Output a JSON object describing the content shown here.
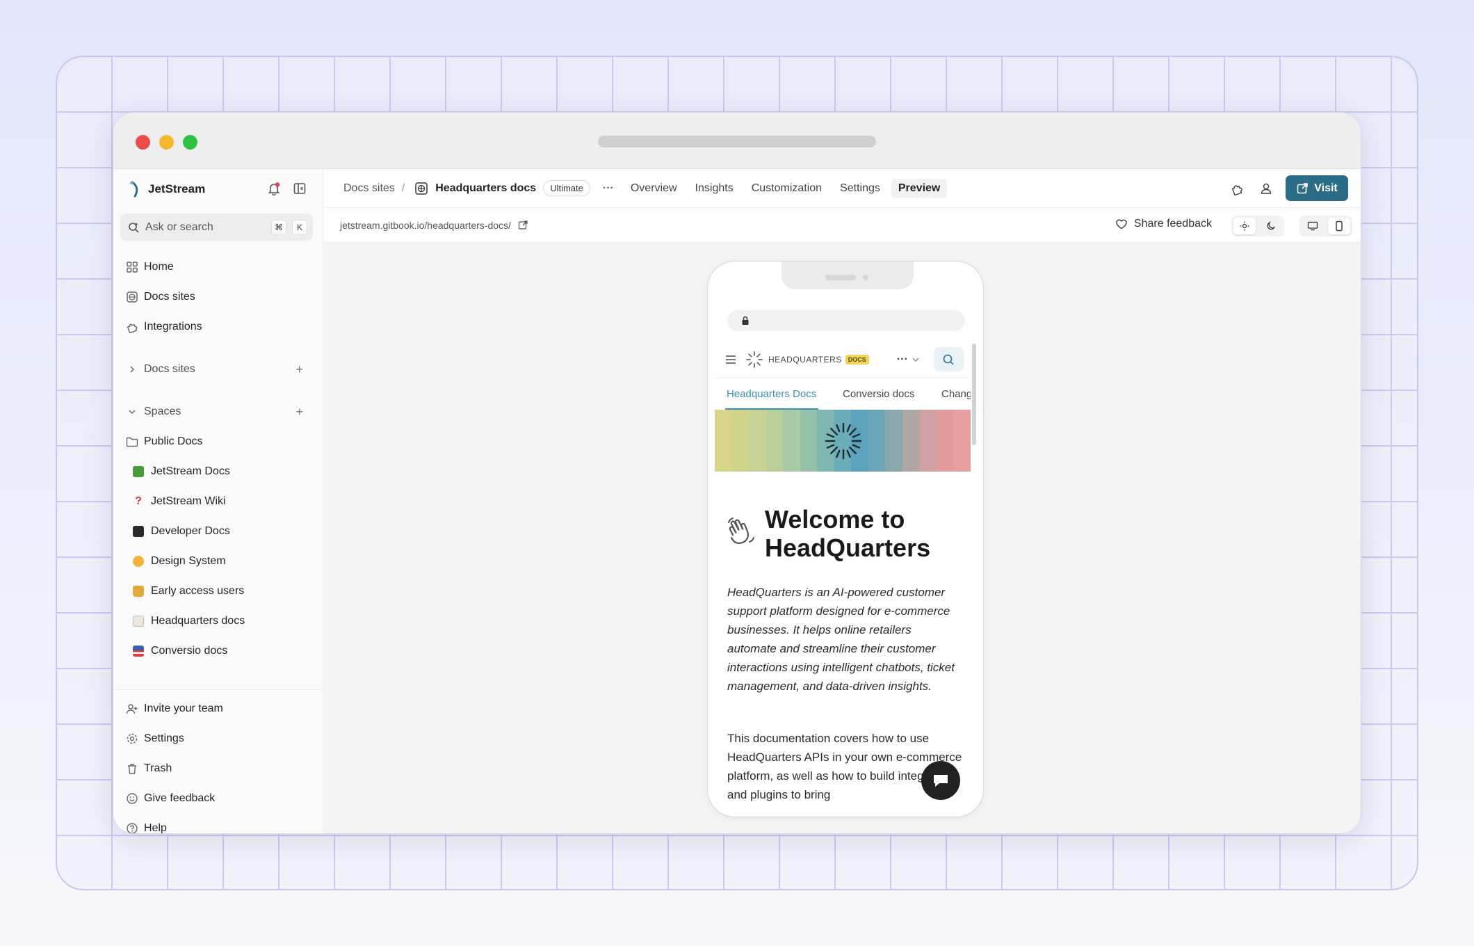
{
  "sidebar": {
    "brand": "JetStream",
    "search_placeholder": "Ask or search",
    "kbd1": "⌘",
    "kbd2": "K",
    "main_items": [
      {
        "label": "Home"
      },
      {
        "label": "Docs sites"
      },
      {
        "label": "Integrations"
      }
    ],
    "docs_sites_section": "Docs sites",
    "spaces_section": "Spaces",
    "folder": "Public Docs",
    "spaces": [
      {
        "label": "JetStream Docs",
        "color": "#4a9a3c"
      },
      {
        "label": "JetStream Wiki",
        "color": "#d33a3a"
      },
      {
        "label": "Developer Docs",
        "color": "#2a2a2a"
      },
      {
        "label": "Design System",
        "color": "#f3b33c"
      },
      {
        "label": "Early access users",
        "color": "#e0a93a"
      },
      {
        "label": "Headquarters docs",
        "color": "#d8d2c8"
      },
      {
        "label": "Conversio docs",
        "color": "#3a5fb0"
      }
    ],
    "bottom_items": [
      {
        "label": "Invite your team"
      },
      {
        "label": "Settings"
      },
      {
        "label": "Trash"
      },
      {
        "label": "Give feedback"
      },
      {
        "label": "Help"
      }
    ]
  },
  "topbar": {
    "crumb_root": "Docs sites",
    "crumb_sep": "/",
    "site_name": "Headquarters docs",
    "plan_badge": "Ultimate",
    "more": "···",
    "tabs": [
      "Overview",
      "Insights",
      "Customization",
      "Settings",
      "Preview"
    ],
    "active_tab": "Preview",
    "visit_label": "Visit"
  },
  "urlbar": {
    "url": "jetstream.gitbook.io/headquarters-docs/",
    "share_feedback": "Share feedback"
  },
  "preview": {
    "logo_text": "HEADQUARTERS",
    "logo_badge": "DOCS",
    "more": "···",
    "tabs": [
      "Headquarters Docs",
      "Conversio docs",
      "Chang"
    ],
    "title_line1": "Welcome to",
    "title_line2": "HeadQuarters",
    "lead": "HeadQuarters is an AI-powered customer support platform designed for e-commerce businesses. It helps online retailers automate and streamline their customer interactions using intelligent chatbots, ticket management, and data-driven insights.",
    "body": "This documentation covers how to use HeadQuarters APIs in your own e-commerce platform, as well as how to build integrations and plugins to bring"
  },
  "colors": {
    "accent": "#2b6d86",
    "active_tab": "#3a8fb7"
  }
}
